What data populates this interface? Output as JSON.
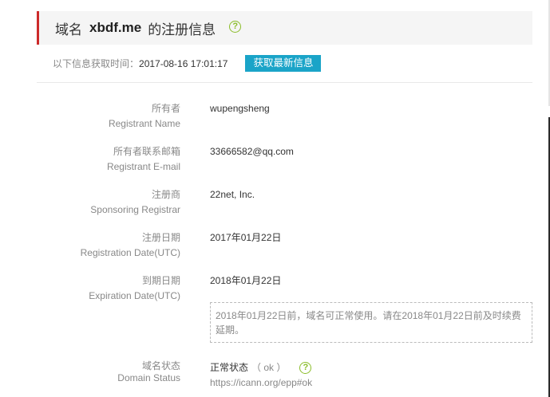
{
  "header": {
    "prefix": "域名",
    "domain": "xbdf.me",
    "suffix": "的注册信息",
    "help_symbol": "?"
  },
  "fetch": {
    "label": "以下信息获取时间：",
    "time": "2017-08-16 17:01:17",
    "refresh_label": "获取最新信息"
  },
  "rows": [
    {
      "label_cn": "所有者",
      "label_en": "Registrant Name",
      "value": "wupengsheng"
    },
    {
      "label_cn": "所有者联系邮箱",
      "label_en": "Registrant E-mail",
      "value": "33666582@qq.com"
    },
    {
      "label_cn": "注册商",
      "label_en": "Sponsoring Registrar",
      "value": "22net, Inc."
    },
    {
      "label_cn": "注册日期",
      "label_en": "Registration Date(UTC)",
      "value": "2017年01月22日"
    },
    {
      "label_cn": "到期日期",
      "label_en": "Expiration Date(UTC)",
      "value": "2018年01月22日"
    }
  ],
  "expiry_notice": {
    "line1": "2018年01月22日前，域名可正常使用。请在2018年01月22日前及时续费",
    "line2": "延期。"
  },
  "status": {
    "label_cn": "域名状态",
    "label_en": "Domain Status",
    "value": "正常状态",
    "code": "（ ok ）",
    "help_symbol": "?",
    "link": "https://icann.org/epp#ok"
  },
  "colors": {
    "accent_red": "#cc2a2a",
    "button_blue": "#1aa4c8",
    "help_green": "#8bbd2a"
  }
}
